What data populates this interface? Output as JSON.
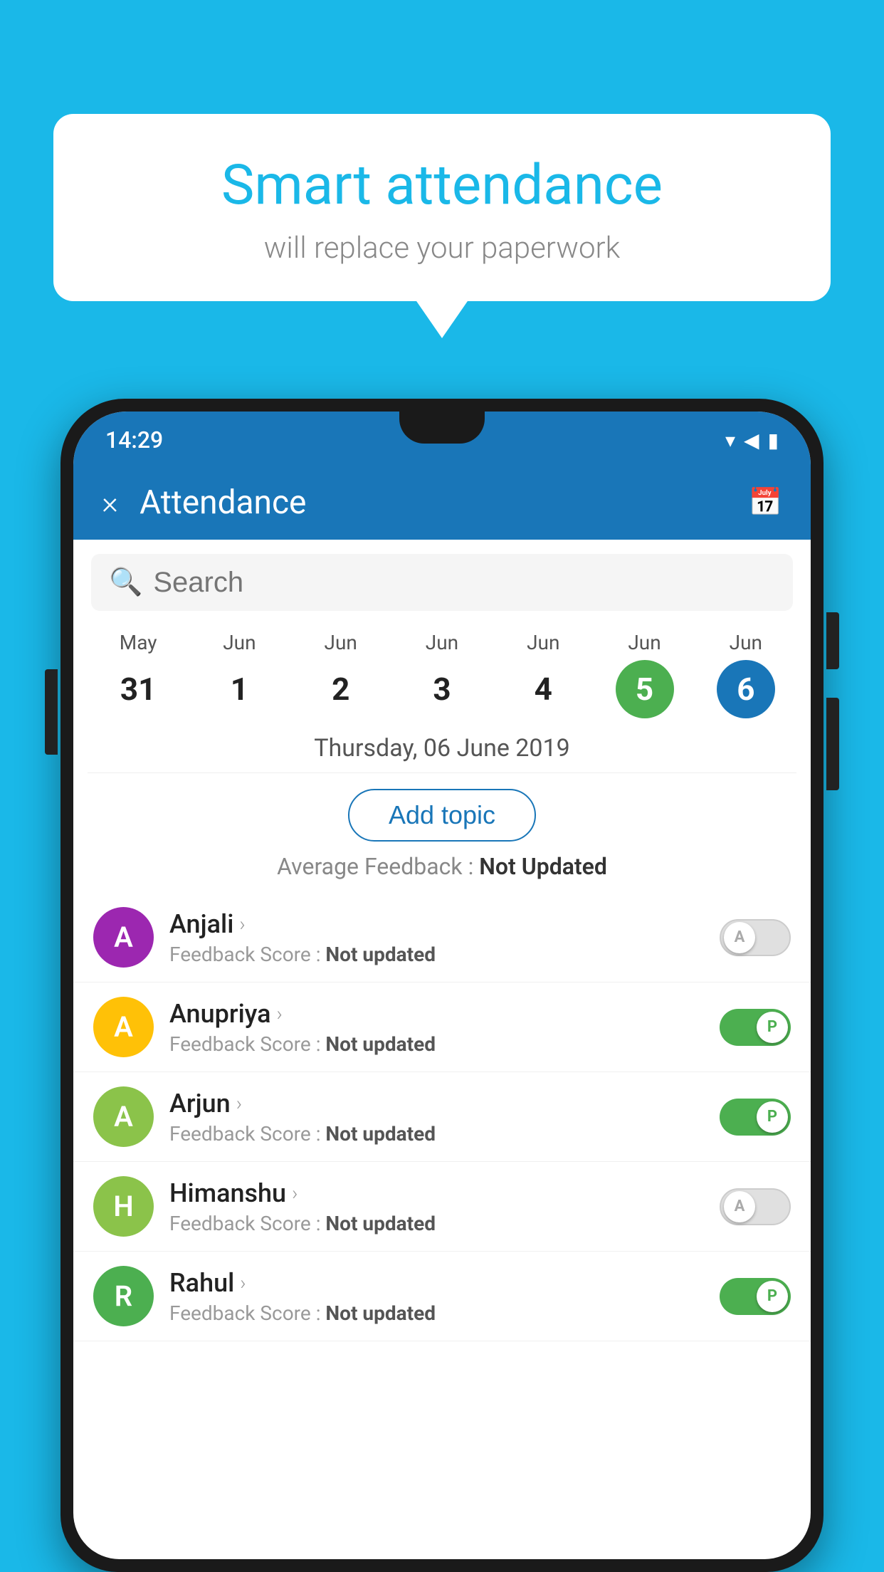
{
  "background_color": "#1ab8e8",
  "bubble": {
    "title": "Smart attendance",
    "subtitle": "will replace your paperwork"
  },
  "status_bar": {
    "time": "14:29",
    "icons": [
      "wifi",
      "signal",
      "battery"
    ]
  },
  "header": {
    "title": "Attendance",
    "close_label": "×",
    "calendar_icon": "📅"
  },
  "search": {
    "placeholder": "Search"
  },
  "calendar": {
    "days": [
      {
        "month": "May",
        "date": "31",
        "state": "normal"
      },
      {
        "month": "Jun",
        "date": "1",
        "state": "normal"
      },
      {
        "month": "Jun",
        "date": "2",
        "state": "normal"
      },
      {
        "month": "Jun",
        "date": "3",
        "state": "normal"
      },
      {
        "month": "Jun",
        "date": "4",
        "state": "normal"
      },
      {
        "month": "Jun",
        "date": "5",
        "state": "today"
      },
      {
        "month": "Jun",
        "date": "6",
        "state": "selected"
      }
    ]
  },
  "selected_date": "Thursday, 06 June 2019",
  "add_topic_label": "Add topic",
  "avg_feedback_label": "Average Feedback : ",
  "avg_feedback_value": "Not Updated",
  "students": [
    {
      "name": "Anjali",
      "avatar_letter": "A",
      "avatar_color": "#9c27b0",
      "feedback_label": "Feedback Score : ",
      "feedback_value": "Not updated",
      "toggle_state": "off",
      "toggle_label": "A"
    },
    {
      "name": "Anupriya",
      "avatar_letter": "A",
      "avatar_color": "#ffc107",
      "feedback_label": "Feedback Score : ",
      "feedback_value": "Not updated",
      "toggle_state": "on",
      "toggle_label": "P"
    },
    {
      "name": "Arjun",
      "avatar_letter": "A",
      "avatar_color": "#8bc34a",
      "feedback_label": "Feedback Score : ",
      "feedback_value": "Not updated",
      "toggle_state": "on",
      "toggle_label": "P"
    },
    {
      "name": "Himanshu",
      "avatar_letter": "H",
      "avatar_color": "#8bc34a",
      "feedback_label": "Feedback Score : ",
      "feedback_value": "Not updated",
      "toggle_state": "off",
      "toggle_label": "A"
    },
    {
      "name": "Rahul",
      "avatar_letter": "R",
      "avatar_color": "#4caf50",
      "feedback_label": "Feedback Score : ",
      "feedback_value": "Not updated",
      "toggle_state": "on",
      "toggle_label": "P"
    }
  ]
}
